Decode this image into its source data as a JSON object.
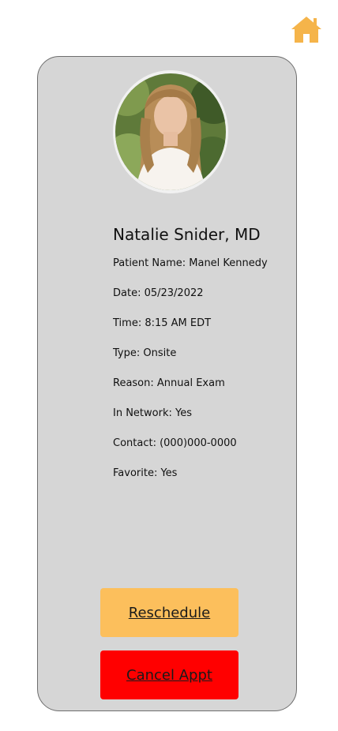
{
  "header": {
    "home_icon": "home-icon",
    "home_color": "#f5b44a"
  },
  "card": {
    "avatar_icon": "doctor-portrait",
    "doctor_name": "Natalie Snider, MD",
    "details": {
      "patient": "Patient Name: Manel Kennedy",
      "date": "Date: 05/23/2022",
      "time": "Time: 8:15 AM EDT",
      "type": "Type: Onsite",
      "reason": "Reason: Annual Exam",
      "in_network": "In Network: Yes",
      "contact": "Contact: (000)000-0000",
      "favorite": "Favorite: Yes"
    },
    "actions": {
      "reschedule_label": "Reschedule",
      "reschedule_color": "#fcbf5c",
      "cancel_label": "Cancel Appt",
      "cancel_color": "#ff0000"
    }
  }
}
